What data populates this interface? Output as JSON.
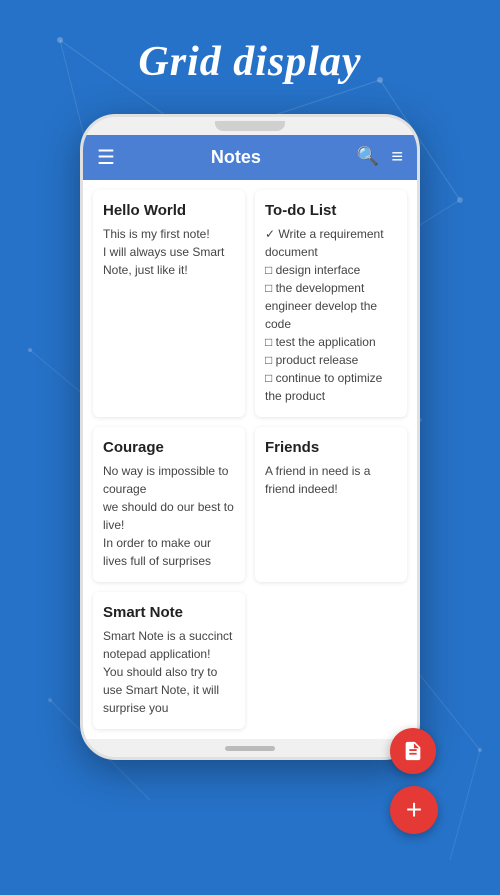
{
  "page": {
    "title": "Grid display",
    "background_color": "#2672c8"
  },
  "header": {
    "title": "Notes",
    "menu_icon": "☰",
    "search_icon": "🔍",
    "filter_icon": "≡"
  },
  "notes": [
    {
      "id": "hello-world",
      "title": "Hello World",
      "body": "This is my first note!\nI will always use Smart Note, just like it!"
    },
    {
      "id": "to-do-list",
      "title": "To-do List",
      "body": "✓ Write a requirement document\n□ design interface\n□ the development engineer develop the code\n□ test the application\n□ product release\n□ continue to optimize the product"
    },
    {
      "id": "courage",
      "title": "Courage",
      "body": "No way is impossible to courage\nwe should do our best to live!\nIn order to make our lives full of surprises"
    },
    {
      "id": "friends",
      "title": "Friends",
      "body": "A friend in need is a friend indeed!"
    },
    {
      "id": "smart-note",
      "title": "Smart Note",
      "body": "Smart Note is a succinct notepad application!\nYou should also try to use Smart Note, it will surprise you"
    }
  ],
  "fabs": [
    {
      "id": "note-icon-fab",
      "icon": "📄",
      "label": "note"
    },
    {
      "id": "add-fab",
      "icon": "+",
      "label": "add"
    }
  ]
}
